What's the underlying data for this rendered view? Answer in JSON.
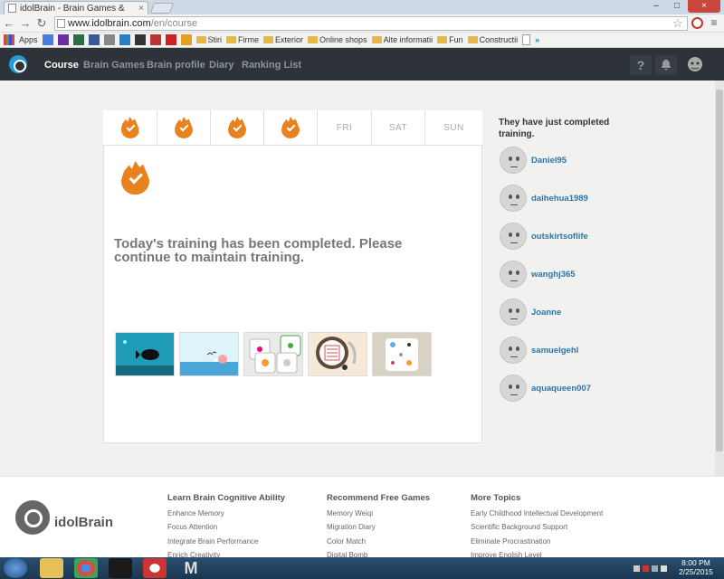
{
  "browser": {
    "tab_title": "idolBrain - Brain Games &",
    "tab_close": "×",
    "url_host": "www.idolbrain.com",
    "url_path": "/en/course",
    "win_min": "–",
    "win_max": "□",
    "win_close": "×"
  },
  "bookmarks": {
    "apps": "Apps",
    "folders": [
      "Stiri",
      "Firme",
      "Exterior",
      "Online shops",
      "Alte informatii",
      "Fun",
      "Constructii"
    ]
  },
  "nav": {
    "links": [
      "Course",
      "Brain Games",
      "Brain profile",
      "Diary",
      "Ranking List"
    ],
    "help": "?"
  },
  "week": {
    "completed_days": 4,
    "upcoming": [
      "FRI",
      "SAT",
      "SUN"
    ]
  },
  "main": {
    "message": "Today's training has been completed. Please continue to maintain training."
  },
  "sidebar": {
    "title": "They have just completed training.",
    "users": [
      "Daniel95",
      "daihehua1989",
      "outskirtsoflife",
      "wanghj365",
      "Joanne",
      "samuelgehl",
      "aquaqueen007"
    ]
  },
  "footer": {
    "logo": "idolBrain",
    "col1": {
      "title": "Learn Brain Cognitive Ability",
      "items": [
        "Enhance Memory",
        "Focus Attention",
        "Integrate Brain Performance",
        "Enrich Creativity"
      ]
    },
    "col2": {
      "title": "Recommend Free Games",
      "items": [
        "Memory Weiqi",
        "Migration Diary",
        "Color Match",
        "Digital Bomb"
      ]
    },
    "col3": {
      "title": "More Topics",
      "items": [
        "Early Childhood Intellectual Development",
        "Scientific Background Support",
        "Eliminate Procrastination",
        "Improve English Level"
      ]
    }
  },
  "taskbar": {
    "time": "8:00 PM",
    "date": "2/25/2015"
  }
}
